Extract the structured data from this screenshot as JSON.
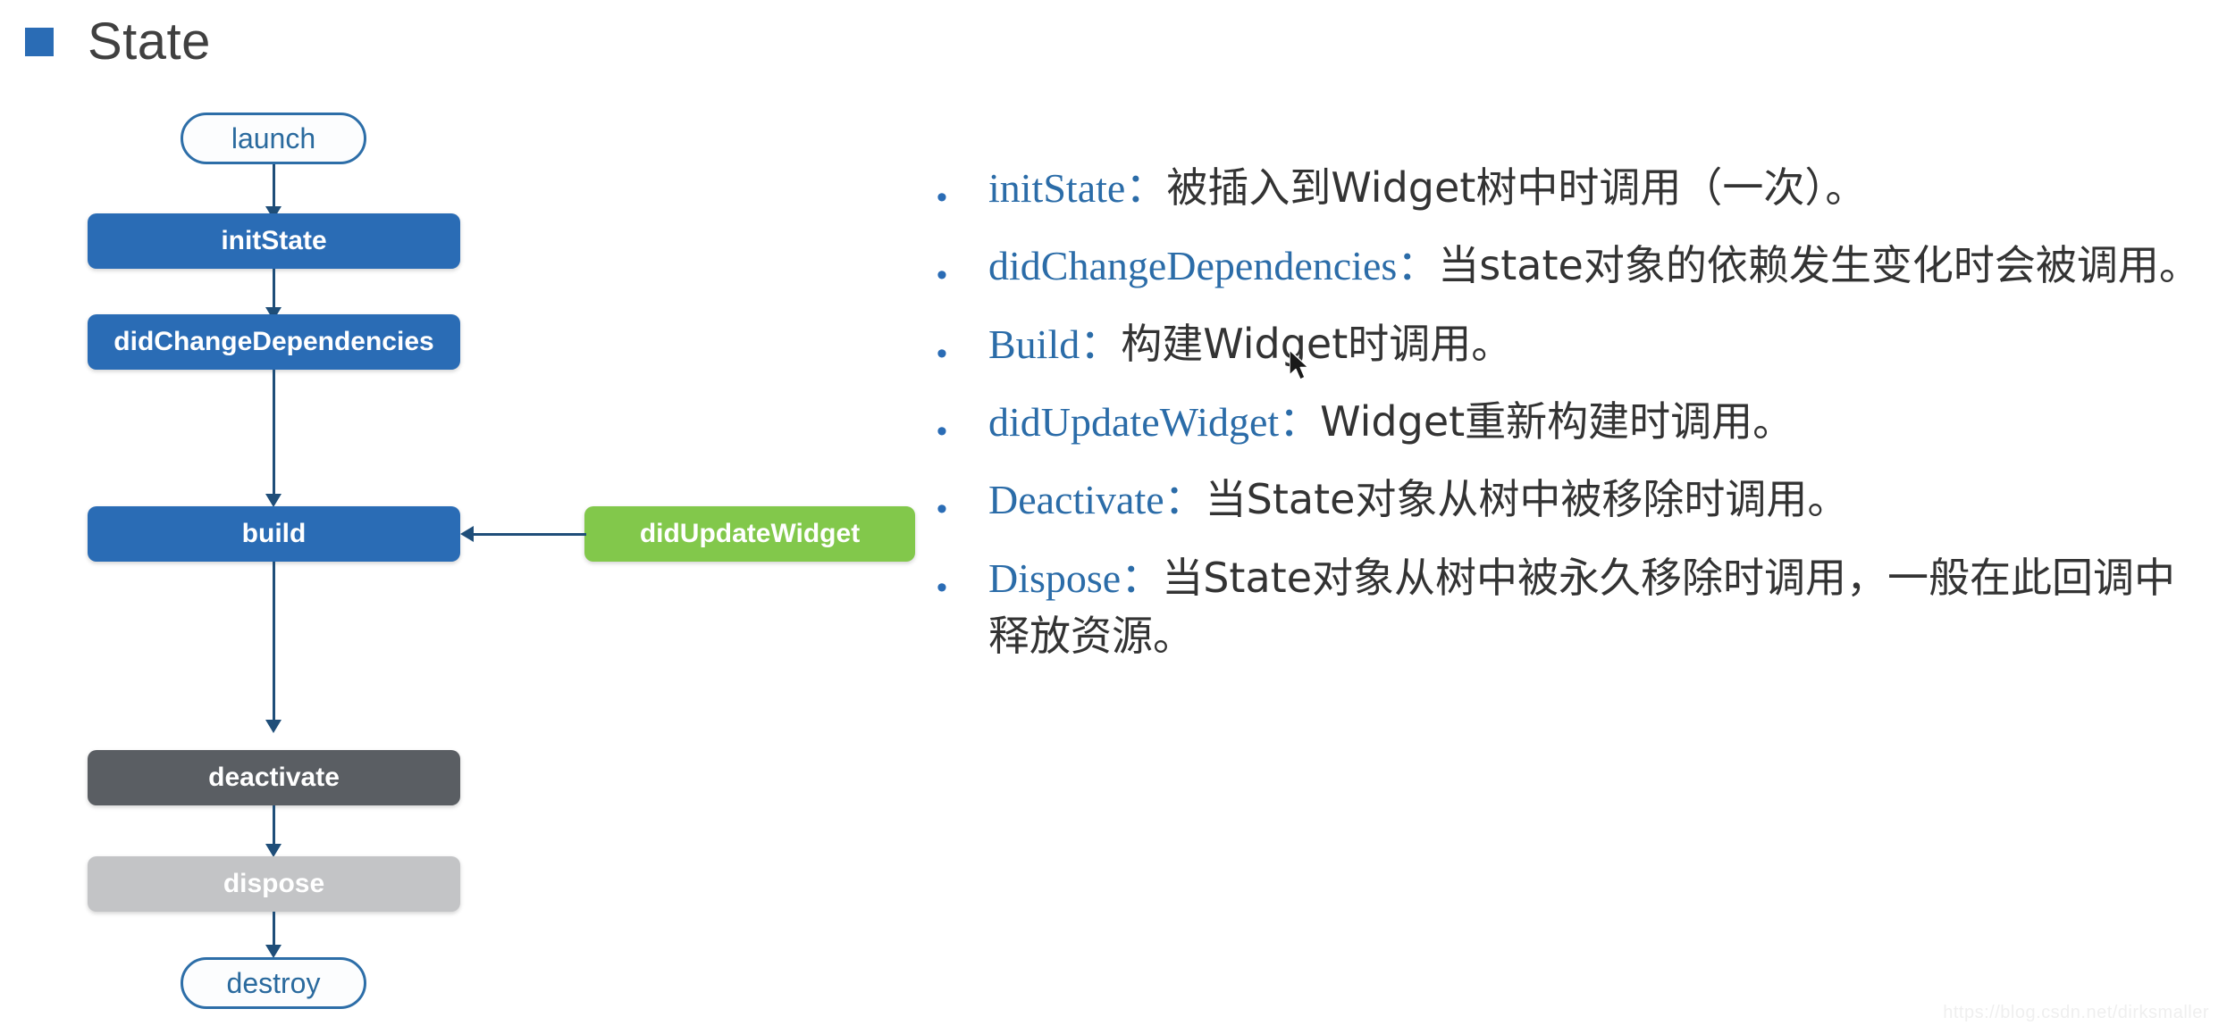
{
  "slide": {
    "title": "State",
    "title_marker_color": "#2A6CB5",
    "background": "#ffffff",
    "watermark": "https://blog.csdn.net/dirksmaller"
  },
  "colors": {
    "blue": "#2A6CB5",
    "green": "#82C84B",
    "dark_gray": "#5A5E63",
    "light_gray": "#C3C4C6",
    "pill_border": "#2D6EA8",
    "pill_text": "#2A6A9E",
    "connector": "#1F4E79",
    "api_text": "#2B6CA8",
    "body_text": "#333333"
  },
  "flowchart": {
    "nodes": [
      {
        "id": "launch",
        "label": "launch",
        "shape": "pill",
        "fill": "#FCFDFE",
        "text_color": "#2A6A9E"
      },
      {
        "id": "initState",
        "label": "initState",
        "shape": "rect",
        "fill": "#2A6CB5",
        "text_color": "#FFFFFF"
      },
      {
        "id": "didChangeDependencies",
        "label": "didChangeDependencies",
        "shape": "rect",
        "fill": "#2A6CB5",
        "text_color": "#FFFFFF"
      },
      {
        "id": "build",
        "label": "build",
        "shape": "rect",
        "fill": "#2A6CB5",
        "text_color": "#FFFFFF"
      },
      {
        "id": "didUpdateWidget",
        "label": "didUpdateWidget",
        "shape": "rect",
        "fill": "#82C84B",
        "text_color": "#FFFFFF"
      },
      {
        "id": "deactivate",
        "label": "deactivate",
        "shape": "rect",
        "fill": "#5A5E63",
        "text_color": "#FFFFFF"
      },
      {
        "id": "dispose",
        "label": "dispose",
        "shape": "rect",
        "fill": "#C3C4C6",
        "text_color": "#FFFFFF"
      },
      {
        "id": "destroy",
        "label": "destroy",
        "shape": "pill",
        "fill": "#FCFDFE",
        "text_color": "#2A6A9E"
      }
    ],
    "edges": [
      {
        "from": "launch",
        "to": "initState",
        "direction": "down"
      },
      {
        "from": "initState",
        "to": "didChangeDependencies",
        "direction": "down"
      },
      {
        "from": "didChangeDependencies",
        "to": "build",
        "direction": "down"
      },
      {
        "from": "didUpdateWidget",
        "to": "build",
        "direction": "left"
      },
      {
        "from": "build",
        "to": "deactivate",
        "direction": "down"
      },
      {
        "from": "deactivate",
        "to": "dispose",
        "direction": "down"
      },
      {
        "from": "dispose",
        "to": "destroy",
        "direction": "down"
      }
    ]
  },
  "bullets": [
    {
      "dot": "•",
      "api": "initState：",
      "desc": "被插入到Widget树中时调用（一次）。"
    },
    {
      "dot": "•",
      "api": "didChangeDependencies：",
      "desc": "当state对象的依赖发生变化时会被调用。"
    },
    {
      "dot": "•",
      "api": "Build：",
      "desc": "构建Widget时调用。"
    },
    {
      "dot": "•",
      "api": "didUpdateWidget：",
      "desc": "Widget重新构建时调用。"
    },
    {
      "dot": "•",
      "api": "Deactivate：",
      "desc": "当State对象从树中被移除时调用。"
    },
    {
      "dot": "•",
      "api": "Dispose：",
      "desc": "当State对象从树中被永久移除时调用，一般在此回调中释放资源。"
    }
  ]
}
